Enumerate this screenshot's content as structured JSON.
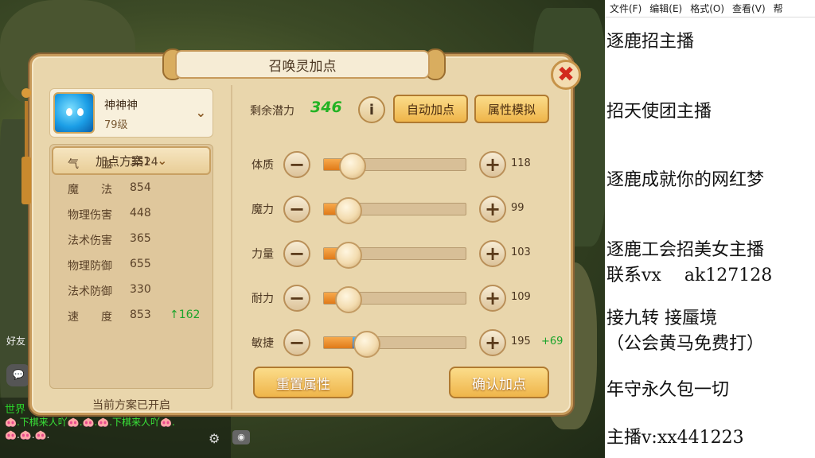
{
  "dialog": {
    "title": "召唤灵加点",
    "close_symbol": "✖"
  },
  "pet": {
    "name": "神神神",
    "level": "79级",
    "dropdown_symbol": "⌄"
  },
  "scheme": {
    "label": "加点方案1",
    "dropdown_symbol": "⌄",
    "status": "当前方案已开启"
  },
  "stats": [
    {
      "label": "气　　血",
      "value": "3524",
      "increase": ""
    },
    {
      "label": "魔　　法",
      "value": "854",
      "increase": ""
    },
    {
      "label": "物理伤害",
      "value": "448",
      "increase": ""
    },
    {
      "label": "法术伤害",
      "value": "365",
      "increase": ""
    },
    {
      "label": "物理防御",
      "value": "655",
      "increase": ""
    },
    {
      "label": "法术防御",
      "value": "330",
      "increase": ""
    },
    {
      "label": "速　　度",
      "value": "853",
      "increase": "↑162"
    }
  ],
  "potential": {
    "label": "剩余潜力",
    "value": "346",
    "info_symbol": "i"
  },
  "buttons": {
    "auto": "自动加点",
    "simulate": "属性模拟",
    "reset": "重置属性",
    "confirm": "确认加点",
    "minus": "−",
    "plus": "+"
  },
  "attributes": [
    {
      "label": "体质",
      "value": "118",
      "bonus": "",
      "level": 0.2,
      "added": 0
    },
    {
      "label": "魔力",
      "value": "99",
      "bonus": "",
      "level": 0.17,
      "added": 0
    },
    {
      "label": "力量",
      "value": "103",
      "bonus": "",
      "level": 0.17,
      "added": 0
    },
    {
      "label": "耐力",
      "value": "109",
      "bonus": "",
      "level": 0.17,
      "added": 0
    },
    {
      "label": "敏捷",
      "value": "195",
      "bonus": "+69",
      "level": 0.2,
      "added": 0.1
    }
  ],
  "chat": {
    "channel": "世界",
    "line1": "🐽.下棋来人吖🐽.🐽.🐽.下棋来人吖🐽.",
    "line2": "🐽.🐽.🐽.",
    "good": "好友",
    "bubble": "💬"
  },
  "notepad": {
    "menu": [
      "文件(F)",
      "编辑(E)",
      "格式(O)",
      "查看(V)",
      "帮"
    ],
    "lines": [
      "逐鹿招主播",
      "招天使团主播",
      "逐鹿成就你的网红梦",
      "逐鹿工会招美女主播",
      "联系vx　 ak127128",
      "接九转 接蜃境",
      "（公会黄马免费打）",
      "年守永久包一切",
      "主播v:xx441223"
    ]
  },
  "colors": {
    "panel_bg": "#e9d6ac",
    "accent_green": "#24b324",
    "slider_fill": "#e07a18",
    "slider_added": "#1b6ed8",
    "close_red": "#d22a1e"
  }
}
